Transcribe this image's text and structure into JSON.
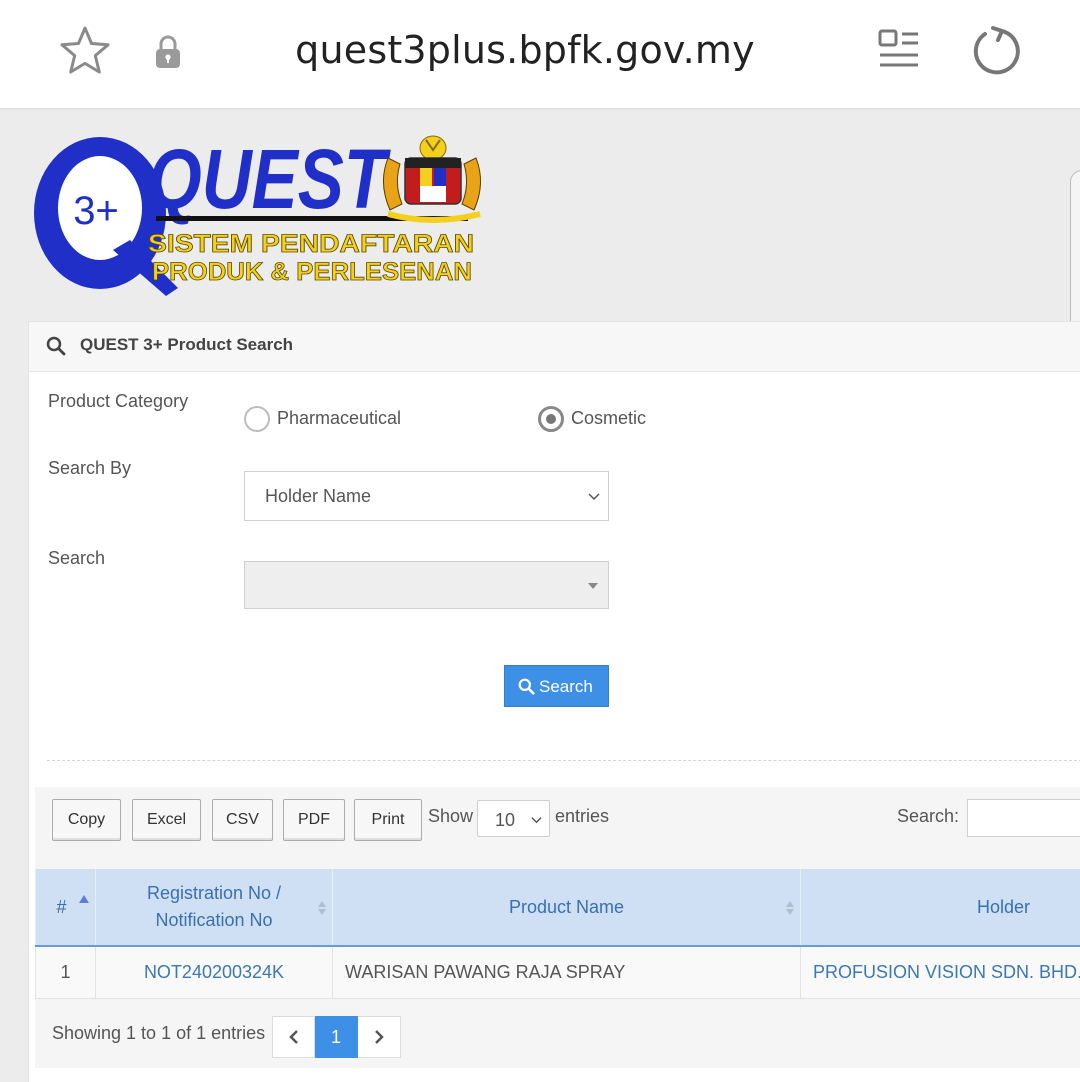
{
  "browser": {
    "url": "quest3plus.bpfk.gov.my",
    "icons": [
      "star-icon",
      "lock-icon",
      "reader-mode-icon",
      "reload-icon"
    ]
  },
  "logo": {
    "badge": "3+",
    "word": "QUEST",
    "line1": "SISTEM PENDAFTARAN",
    "line2": "PRODUK & PERLESENAN",
    "colors": {
      "blue": "#1f2fc8",
      "yellow": "#f4d01e"
    }
  },
  "panel": {
    "title": "QUEST 3+ Product Search",
    "category_label": "Product Category",
    "categories": [
      {
        "label": "Pharmaceutical",
        "selected": false
      },
      {
        "label": "Cosmetic",
        "selected": true
      }
    ],
    "search_by_label": "Search By",
    "search_by_value": "Holder Name",
    "search_label": "Search",
    "search_value": "",
    "search_button": "Search"
  },
  "table_tools": {
    "buttons": [
      "Copy",
      "Excel",
      "CSV",
      "PDF",
      "Print"
    ],
    "show_label": "Show",
    "entries_value": "10",
    "entries_label": "entries",
    "filter_label": "Search:",
    "filter_value": ""
  },
  "table": {
    "columns": [
      "#",
      "Registration No / Notification No",
      "Product Name",
      "Holder"
    ],
    "rows": [
      {
        "num": "1",
        "reg_no": "NOT240200324K",
        "product": "WARISAN PAWANG RAJA SPRAY",
        "holder": "PROFUSION VISION SDN. BHD."
      }
    ]
  },
  "footer": {
    "info": "Showing 1 to 1 of 1 entries",
    "current_page": "1"
  },
  "colors": {
    "accent": "#3d90e6",
    "header_bg": "#cfe0f5",
    "link": "#3a78b6"
  }
}
